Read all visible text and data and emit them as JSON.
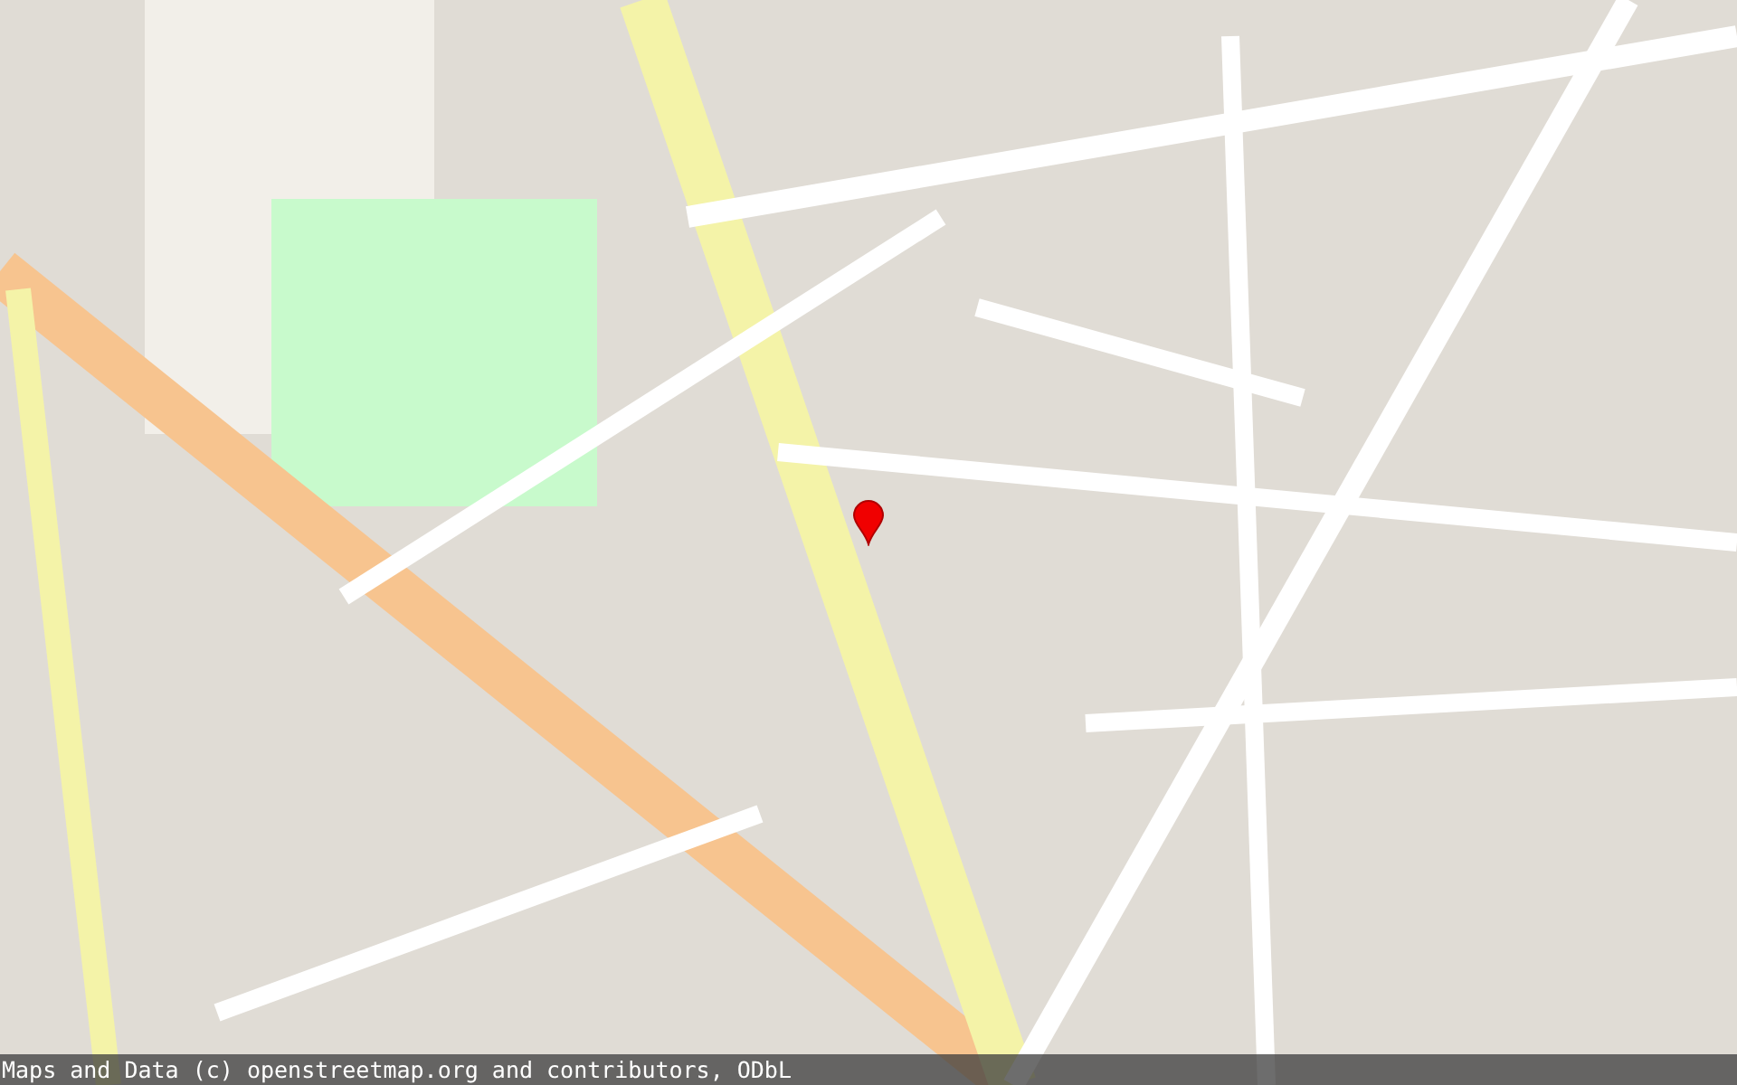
{
  "map": {
    "attribution": "Maps and Data (c) openstreetmap.org and contributors, ODbL"
  }
}
